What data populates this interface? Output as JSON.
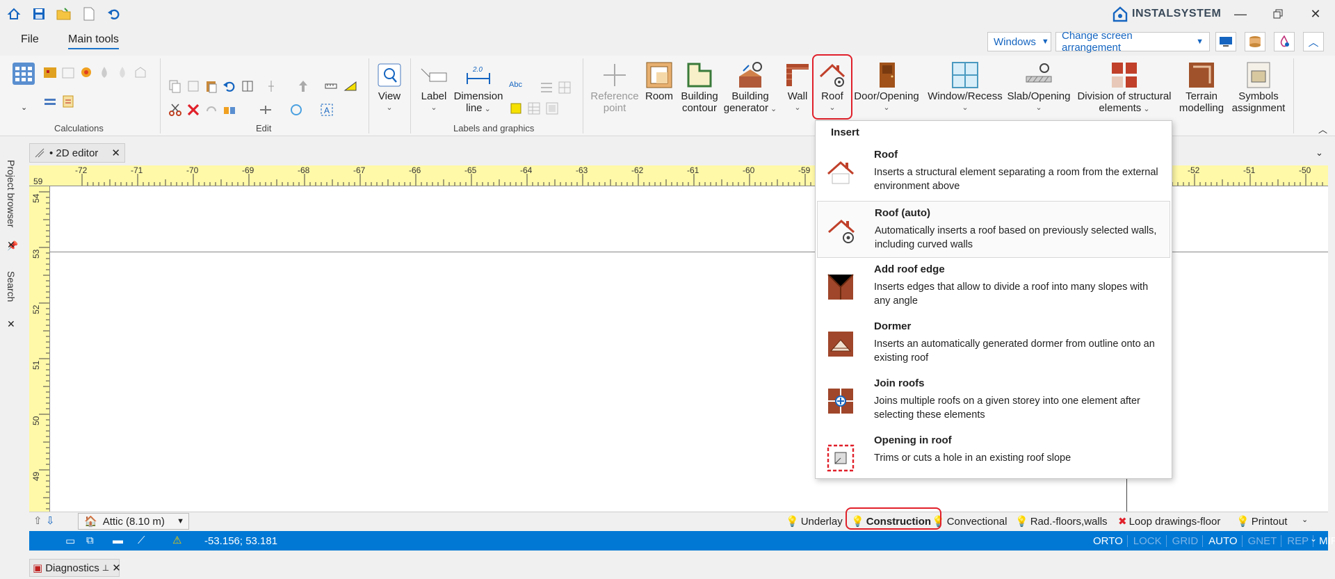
{
  "app": {
    "brand": "INSTALSYSTEM"
  },
  "menu": {
    "file": "File",
    "main_tools": "Main tools"
  },
  "header_controls": {
    "windows": "Windows",
    "screen_arrangement": "Change screen arrangement"
  },
  "ribbon": {
    "groups": {
      "calculations": "Calculations",
      "edit": "Edit",
      "labels_graphics": "Labels and graphics"
    },
    "tools": {
      "view": "View",
      "label": "Label",
      "dimension_line_1": "Dimension",
      "dimension_line_2": "line",
      "dimension_badge": "2.0",
      "abc": "Abc",
      "reference_point_1": "Reference",
      "reference_point_2": "point",
      "room": "Room",
      "building_contour_1": "Building",
      "building_contour_2": "contour",
      "building_generator_1": "Building",
      "building_generator_2": "generator",
      "wall": "Wall",
      "roof": "Roof",
      "door_opening": "Door/Opening",
      "window_recess": "Window/Recess",
      "slab_opening": "Slab/Opening",
      "division_1": "Division of structural",
      "division_2": "elements",
      "terrain_1": "Terrain",
      "terrain_2": "modelling",
      "symbols_1": "Symbols",
      "symbols_2": "assignment"
    }
  },
  "side_panels": {
    "project_browser": "Project browser",
    "search": "Search"
  },
  "editor_tab": {
    "label": "• 2D editor"
  },
  "ruler": {
    "corner": "59",
    "h_ticks": [
      "-72",
      "-71",
      "-70",
      "-69",
      "-68",
      "-67",
      "-66",
      "-65",
      "-64",
      "-63",
      "-62",
      "-61",
      "-60",
      "-59",
      "",
      "",
      "",
      "",
      "",
      "",
      "-52",
      "-51",
      "-50"
    ],
    "v_ticks": [
      "54",
      "53",
      "52",
      "51",
      "50",
      "49"
    ]
  },
  "bottom": {
    "storey": "Attic (8.10 m)",
    "layers": [
      "Underlay",
      "Construction",
      "Convectional",
      "Rad.-floors,walls",
      "Loop drawings-floor",
      "Printout"
    ]
  },
  "status": {
    "coords": "-53.156; 53.181",
    "flags": [
      {
        "label": "ORTO",
        "active": true
      },
      {
        "label": "LOCK",
        "active": false
      },
      {
        "label": "GRID",
        "active": false
      },
      {
        "label": "AUTO",
        "active": true
      },
      {
        "label": "GNET",
        "active": false
      },
      {
        "label": "REP",
        "active": false
      },
      {
        "label": "MIRO",
        "active": true
      }
    ]
  },
  "diagnostics": {
    "label": "Diagnostics"
  },
  "dropdown": {
    "heading": "Insert",
    "items": [
      {
        "title": "Roof",
        "desc": "Inserts a structural element separating a room from the external environment above",
        "icon": "roof-icon"
      },
      {
        "title": "Roof (auto)",
        "desc": "Automatically inserts a roof based on previously selected walls, including curved walls",
        "icon": "roof-auto-icon"
      },
      {
        "title": "Add roof edge",
        "desc": "Inserts edges that allow to divide a roof into many slopes with any angle",
        "icon": "roof-edge-icon"
      },
      {
        "title": "Dormer",
        "desc": "Inserts an automatically generated dormer from outline onto an existing roof",
        "icon": "dormer-icon"
      },
      {
        "title": "Join roofs",
        "desc": "Joins multiple roofs on a given storey into one element after selecting these elements",
        "icon": "join-roofs-icon"
      },
      {
        "title": "Opening in roof",
        "desc": "Trims or cuts a hole in an existing roof slope",
        "icon": "roof-opening-icon"
      }
    ]
  },
  "colors": {
    "accent": "#0078d4",
    "highlight_red": "#e0202a",
    "ruler": "#fff9a8"
  }
}
